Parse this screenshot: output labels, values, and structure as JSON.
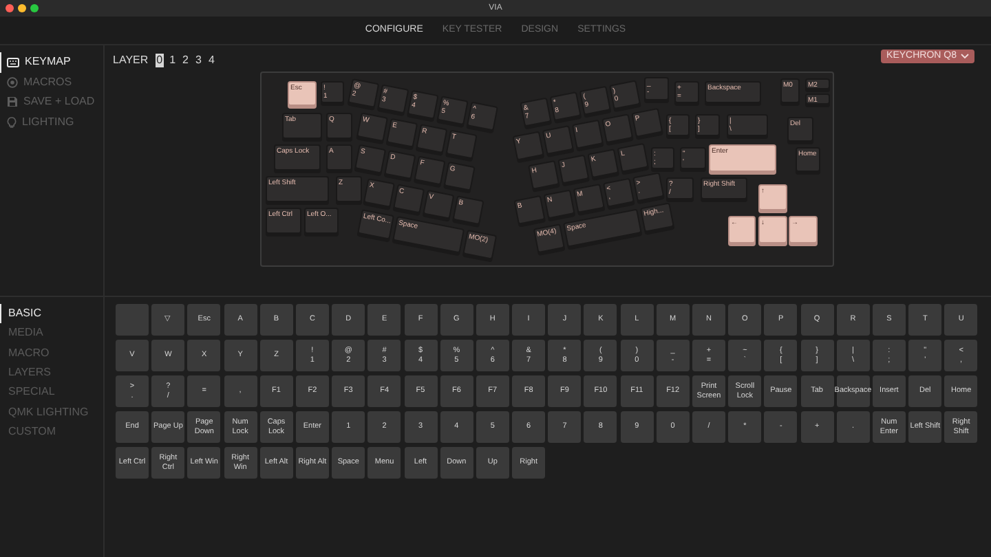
{
  "window": {
    "title": "VIA"
  },
  "nav": {
    "tabs": [
      {
        "label": "CONFIGURE",
        "selected": true
      },
      {
        "label": "KEY TESTER",
        "selected": false
      },
      {
        "label": "DESIGN",
        "selected": false
      },
      {
        "label": "SETTINGS",
        "selected": false
      }
    ]
  },
  "sidebar": {
    "items": [
      {
        "label": "KEYMAP",
        "selected": true
      },
      {
        "label": "MACROS",
        "selected": false
      },
      {
        "label": "SAVE + LOAD",
        "selected": false
      },
      {
        "label": "LIGHTING",
        "selected": false
      }
    ]
  },
  "layers": {
    "label": "LAYER",
    "items": [
      {
        "label": "0",
        "selected": true
      },
      {
        "label": "1",
        "selected": false
      },
      {
        "label": "2",
        "selected": false
      },
      {
        "label": "3",
        "selected": false
      },
      {
        "label": "4",
        "selected": false
      }
    ]
  },
  "device_dropdown": {
    "value": "KEYCHRON Q8"
  },
  "keyboard": {
    "left_keys": [
      {
        "legend": [
          "Esc"
        ],
        "accent": true
      },
      {
        "legend": [
          "!",
          "1"
        ],
        "accent": false
      },
      {
        "legend": [
          "Tab"
        ],
        "accent": false
      },
      {
        "legend": [
          "Q"
        ],
        "accent": false
      },
      {
        "legend": [
          "Caps Lock"
        ],
        "accent": false
      },
      {
        "legend": [
          "A"
        ],
        "accent": false
      },
      {
        "legend": [
          "Left Shift"
        ],
        "accent": false
      },
      {
        "legend": [
          "Z"
        ],
        "accent": false
      },
      {
        "legend": [
          "Left Ctrl"
        ],
        "accent": false
      },
      {
        "legend": [
          "Left O..."
        ],
        "accent": false
      }
    ],
    "left_cluster": [
      {
        "legend": [
          "@",
          "2"
        ],
        "accent": false
      },
      {
        "legend": [
          "#",
          "3"
        ],
        "accent": false
      },
      {
        "legend": [
          "$",
          "4"
        ],
        "accent": false
      },
      {
        "legend": [
          "%",
          "5"
        ],
        "accent": false
      },
      {
        "legend": [
          "^",
          "6"
        ],
        "accent": false
      },
      {
        "legend": [
          "W"
        ],
        "accent": false
      },
      {
        "legend": [
          "E"
        ],
        "accent": false
      },
      {
        "legend": [
          "R"
        ],
        "accent": false
      },
      {
        "legend": [
          "T"
        ],
        "accent": false
      },
      {
        "legend": [
          "S"
        ],
        "accent": false
      },
      {
        "legend": [
          "D"
        ],
        "accent": false
      },
      {
        "legend": [
          "F"
        ],
        "accent": false
      },
      {
        "legend": [
          "G"
        ],
        "accent": false
      },
      {
        "legend": [
          "X"
        ],
        "accent": false
      },
      {
        "legend": [
          "C"
        ],
        "accent": false
      },
      {
        "legend": [
          "V"
        ],
        "accent": false
      },
      {
        "legend": [
          "B"
        ],
        "accent": false
      },
      {
        "legend": [
          "Left Co..."
        ],
        "accent": false
      },
      {
        "legend": [
          "Space"
        ],
        "accent": false
      },
      {
        "legend": [
          "MO(2)"
        ],
        "accent": false
      }
    ],
    "right_cluster": [
      {
        "legend": [
          "&",
          "7"
        ],
        "accent": false
      },
      {
        "legend": [
          "*",
          "8"
        ],
        "accent": false
      },
      {
        "legend": [
          "(",
          "9"
        ],
        "accent": false
      },
      {
        "legend": [
          ")",
          "0"
        ],
        "accent": false
      },
      {
        "legend": [
          "Y"
        ],
        "accent": false
      },
      {
        "legend": [
          "U"
        ],
        "accent": false
      },
      {
        "legend": [
          "I"
        ],
        "accent": false
      },
      {
        "legend": [
          "O"
        ],
        "accent": false
      },
      {
        "legend": [
          "P"
        ],
        "accent": false
      },
      {
        "legend": [
          "H"
        ],
        "accent": false
      },
      {
        "legend": [
          "J"
        ],
        "accent": false
      },
      {
        "legend": [
          "K"
        ],
        "accent": false
      },
      {
        "legend": [
          "L"
        ],
        "accent": false
      },
      {
        "legend": [
          "B"
        ],
        "accent": false
      },
      {
        "legend": [
          "N"
        ],
        "accent": false
      },
      {
        "legend": [
          "M"
        ],
        "accent": false
      },
      {
        "legend": [
          "<",
          ","
        ],
        "accent": false
      },
      {
        "legend": [
          ">",
          "."
        ],
        "accent": false
      },
      {
        "legend": [
          "MO(4)"
        ],
        "accent": false
      },
      {
        "legend": [
          "Space"
        ],
        "accent": false
      },
      {
        "legend": [
          "High..."
        ],
        "accent": false
      }
    ],
    "right_keys": [
      {
        "legend": [
          "_",
          "-"
        ],
        "accent": false
      },
      {
        "legend": [
          "+",
          "="
        ],
        "accent": false
      },
      {
        "legend": [
          "Backspace"
        ],
        "accent": false
      },
      {
        "legend": [
          "M0"
        ],
        "accent": false
      },
      {
        "legend": [
          "M2"
        ],
        "accent": false
      },
      {
        "legend": [
          "M1"
        ],
        "accent": false
      },
      {
        "legend": [
          "{",
          "["
        ],
        "accent": false
      },
      {
        "legend": [
          "}",
          "]"
        ],
        "accent": false
      },
      {
        "legend": [
          "|",
          "\\"
        ],
        "accent": false
      },
      {
        "legend": [
          "Del"
        ],
        "accent": false
      },
      {
        "legend": [
          ":",
          ";"
        ],
        "accent": false
      },
      {
        "legend": [
          "\"",
          "'"
        ],
        "accent": false
      },
      {
        "legend": [
          "Enter"
        ],
        "accent": true
      },
      {
        "legend": [
          "Home"
        ],
        "accent": false
      },
      {
        "legend": [
          "?",
          "/"
        ],
        "accent": false
      },
      {
        "legend": [
          "Right Shift"
        ],
        "accent": false
      },
      {
        "legend": [
          "↑"
        ],
        "accent": true
      },
      {
        "legend": [
          "←"
        ],
        "accent": true
      },
      {
        "legend": [
          "↓"
        ],
        "accent": true
      },
      {
        "legend": [
          "→"
        ],
        "accent": true
      }
    ]
  },
  "categories": {
    "items": [
      {
        "label": "BASIC",
        "selected": true
      },
      {
        "label": "MEDIA",
        "selected": false
      },
      {
        "label": "MACRO",
        "selected": false
      },
      {
        "label": "LAYERS",
        "selected": false
      },
      {
        "label": "SPECIAL",
        "selected": false
      },
      {
        "label": "QMK LIGHTING",
        "selected": false
      },
      {
        "label": "CUSTOM",
        "selected": false
      }
    ]
  },
  "palette": {
    "rows": [
      [
        {},
        {
          "legend": [
            "▽"
          ]
        },
        {
          "legend": [
            "Esc"
          ]
        },
        {
          "legend": [
            "A"
          ]
        },
        {
          "legend": [
            "B"
          ]
        },
        {
          "legend": [
            "C"
          ]
        },
        {
          "legend": [
            "D"
          ]
        },
        {
          "legend": [
            "E"
          ]
        },
        {
          "legend": [
            "F"
          ]
        },
        {
          "legend": [
            "G"
          ]
        },
        {
          "legend": [
            "H"
          ]
        },
        {
          "legend": [
            "I"
          ]
        },
        {
          "legend": [
            "J"
          ]
        },
        {
          "legend": [
            "K"
          ]
        },
        {
          "legend": [
            "L"
          ]
        },
        {
          "legend": [
            "M"
          ]
        },
        {
          "legend": [
            "N"
          ]
        },
        {
          "legend": [
            "O"
          ]
        },
        {
          "legend": [
            "P"
          ]
        },
        {
          "legend": [
            "Q"
          ]
        },
        {
          "legend": [
            "R"
          ]
        },
        {
          "legend": [
            "S"
          ]
        },
        {
          "legend": [
            "T"
          ]
        },
        {
          "legend": [
            "U"
          ]
        }
      ],
      [
        {
          "legend": [
            "V"
          ]
        },
        {
          "legend": [
            "W"
          ]
        },
        {
          "legend": [
            "X"
          ]
        },
        {
          "legend": [
            "Y"
          ]
        },
        {
          "legend": [
            "Z"
          ]
        },
        {
          "legend": [
            "!",
            "1"
          ]
        },
        {
          "legend": [
            "@",
            "2"
          ]
        },
        {
          "legend": [
            "#",
            "3"
          ]
        },
        {
          "legend": [
            "$",
            "4"
          ]
        },
        {
          "legend": [
            "%",
            "5"
          ]
        },
        {
          "legend": [
            "^",
            "6"
          ]
        },
        {
          "legend": [
            "&",
            "7"
          ]
        },
        {
          "legend": [
            "*",
            "8"
          ]
        },
        {
          "legend": [
            "(",
            "9"
          ]
        },
        {
          "legend": [
            ")",
            "0"
          ]
        },
        {
          "legend": [
            "_",
            "-"
          ]
        },
        {
          "legend": [
            "+",
            "="
          ]
        },
        {
          "legend": [
            "~",
            "`"
          ]
        },
        {
          "legend": [
            "{",
            "["
          ]
        },
        {
          "legend": [
            "}",
            "]"
          ]
        },
        {
          "legend": [
            "|",
            "\\"
          ]
        },
        {
          "legend": [
            ":",
            ";"
          ]
        },
        {
          "legend": [
            "\"",
            "'"
          ]
        },
        {
          "legend": [
            "<",
            ","
          ]
        }
      ],
      [
        {
          "legend": [
            ">",
            "."
          ]
        },
        {
          "legend": [
            "?",
            "/"
          ]
        },
        {
          "legend": [
            "="
          ]
        },
        {
          "legend": [
            ","
          ]
        },
        {
          "legend": [
            "F1"
          ]
        },
        {
          "legend": [
            "F2"
          ]
        },
        {
          "legend": [
            "F3"
          ]
        },
        {
          "legend": [
            "F4"
          ]
        },
        {
          "legend": [
            "F5"
          ]
        },
        {
          "legend": [
            "F6"
          ]
        },
        {
          "legend": [
            "F7"
          ]
        },
        {
          "legend": [
            "F8"
          ]
        },
        {
          "legend": [
            "F9"
          ]
        },
        {
          "legend": [
            "F10"
          ]
        },
        {
          "legend": [
            "F11"
          ]
        },
        {
          "legend": [
            "F12"
          ]
        },
        {
          "legend": [
            "Print Screen"
          ]
        },
        {
          "legend": [
            "Scroll Lock"
          ]
        },
        {
          "legend": [
            "Pause"
          ]
        },
        {
          "legend": [
            "Tab"
          ]
        },
        {
          "legend": [
            "Backspace"
          ]
        },
        {
          "legend": [
            "Insert"
          ]
        },
        {
          "legend": [
            "Del"
          ]
        },
        {
          "legend": [
            "Home"
          ]
        }
      ],
      [
        {
          "legend": [
            "End"
          ]
        },
        {
          "legend": [
            "Page Up"
          ]
        },
        {
          "legend": [
            "Page Down"
          ]
        },
        {
          "legend": [
            "Num Lock"
          ]
        },
        {
          "legend": [
            "Caps Lock"
          ]
        },
        {
          "legend": [
            "Enter"
          ]
        },
        {
          "legend": [
            "1"
          ]
        },
        {
          "legend": [
            "2"
          ]
        },
        {
          "legend": [
            "3"
          ]
        },
        {
          "legend": [
            "4"
          ]
        },
        {
          "legend": [
            "5"
          ]
        },
        {
          "legend": [
            "6"
          ]
        },
        {
          "legend": [
            "7"
          ]
        },
        {
          "legend": [
            "8"
          ]
        },
        {
          "legend": [
            "9"
          ]
        },
        {
          "legend": [
            "0"
          ]
        },
        {
          "legend": [
            "/"
          ]
        },
        {
          "legend": [
            "*"
          ]
        },
        {
          "legend": [
            "-"
          ]
        },
        {
          "legend": [
            "+"
          ]
        },
        {
          "legend": [
            "."
          ]
        },
        {
          "legend": [
            "Num Enter"
          ]
        },
        {
          "legend": [
            "Left Shift"
          ]
        },
        {
          "legend": [
            "Right Shift"
          ]
        }
      ],
      [
        {
          "legend": [
            "Left Ctrl"
          ]
        },
        {
          "legend": [
            "Right Ctrl"
          ]
        },
        {
          "legend": [
            "Left Win"
          ]
        },
        {
          "legend": [
            "Right Win"
          ]
        },
        {
          "legend": [
            "Left Alt"
          ]
        },
        {
          "legend": [
            "Right Alt"
          ]
        },
        {
          "legend": [
            "Space"
          ]
        },
        {
          "legend": [
            "Menu"
          ]
        },
        {
          "legend": [
            "Left"
          ]
        },
        {
          "legend": [
            "Down"
          ]
        },
        {
          "legend": [
            "Up"
          ]
        },
        {
          "legend": [
            "Right"
          ]
        }
      ]
    ]
  }
}
